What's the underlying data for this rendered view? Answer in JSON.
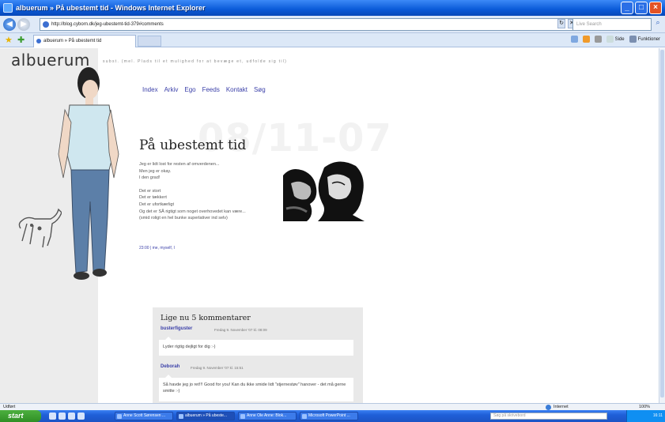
{
  "window": {
    "title": "albuerum » På ubestemt tid - Windows Internet Explorer"
  },
  "addressbar": {
    "url": "http://blog.cyborn.dk/jeg-ubestemt-tid-379#comments",
    "search_placeholder": "Live Search"
  },
  "tabs": [
    {
      "label": "albuerum » På ubestemt tid"
    }
  ],
  "commandbar": {
    "page_label": "Side",
    "tools_label": "Funktioner"
  },
  "site": {
    "brand": "albuerum",
    "tagline": "subst. (mel. Plads til et mulighed for at bevæge et, udfolde sig til)",
    "nav": [
      "Index",
      "Arkiv",
      "Ego",
      "Feeds",
      "Kontakt",
      "Søg"
    ]
  },
  "post": {
    "date_watermark": "08/11-07",
    "title": "På ubestemt tid",
    "paragraph1": [
      "Jeg er lidt lost for resten af omverdenen...",
      "Men jeg er okay.",
      "I den grad!"
    ],
    "paragraph2": [
      "Det er stort",
      "Det er tækkert",
      "Det er ufortkærligt",
      "Og det er SÅ rigtigt som noget overhovedet kan være...",
      "(smid roligt en hel bunke superlativer ind selv)"
    ],
    "meta": "23:00 | me, myself, I"
  },
  "comments": {
    "title": "Lige nu 5 kommentarer",
    "items": [
      {
        "author": "busterfiguster",
        "date": "Fredag 9. November '07 kl. 08:09",
        "text": "Lyder rigtig dejligt for dig :-)"
      },
      {
        "author": "Deborah",
        "date": "Fredag 9. November '07 kl. 15:51",
        "text": "Så havde jeg jo ret!!! Good for you! Kan du ikke smide lidt \"stjernestøv\" hanover - det må gerne smitte :-)"
      }
    ]
  },
  "statusbar": {
    "left": "Udført",
    "zone": "Internet",
    "zoom": "100%"
  },
  "taskbar": {
    "start": "start",
    "tasks": [
      "Anne Scott Sørensen ...",
      "albuerum » På ubeste...",
      "Anne Ole Anne: Blok...",
      "Microsoft PowerPoint ..."
    ],
    "search_placeholder": "Søg på skrivebord",
    "clock": "16:11"
  }
}
